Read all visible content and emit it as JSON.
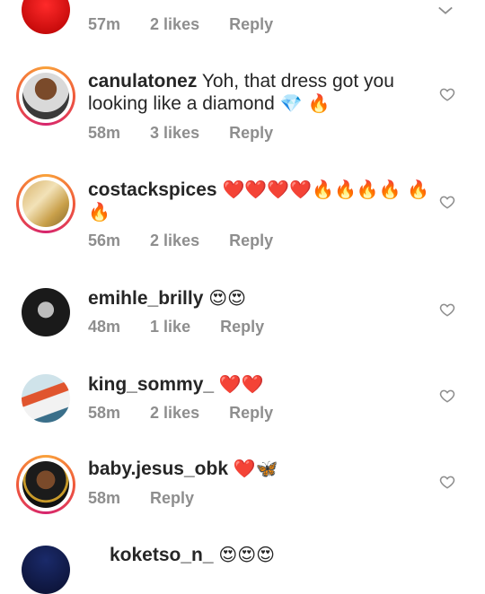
{
  "comments": [
    {
      "username": "",
      "text": "",
      "time": "57m",
      "likes": "2 likes",
      "reply": "Reply"
    },
    {
      "username": "canulatonez",
      "text": "Yoh, that dress got you looking like a diamond",
      "emoji": "💎 🔥",
      "time": "58m",
      "likes": "3 likes",
      "reply": "Reply"
    },
    {
      "username": "costackspices",
      "text": "",
      "emoji": "❤️❤️❤️❤️🔥🔥🔥🔥 🔥🔥",
      "time": "56m",
      "likes": "2 likes",
      "reply": "Reply"
    },
    {
      "username": "emihle_brilly",
      "text": "",
      "emoji": "😍😍",
      "time": "48m",
      "likes": "1 like",
      "reply": "Reply"
    },
    {
      "username": "king_sommy_",
      "text": "",
      "emoji": "❤️❤️",
      "time": "58m",
      "likes": "2 likes",
      "reply": "Reply"
    },
    {
      "username": "baby.jesus_obk",
      "text": "",
      "emoji": "❤️🦋",
      "time": "58m",
      "likes": "",
      "reply": "Reply"
    },
    {
      "username": "koketso_n_",
      "text": "",
      "emoji": "😍😍😍"
    }
  ],
  "icons": {
    "like": "heart-outline-icon",
    "collapse": "chevron-down-icon"
  }
}
